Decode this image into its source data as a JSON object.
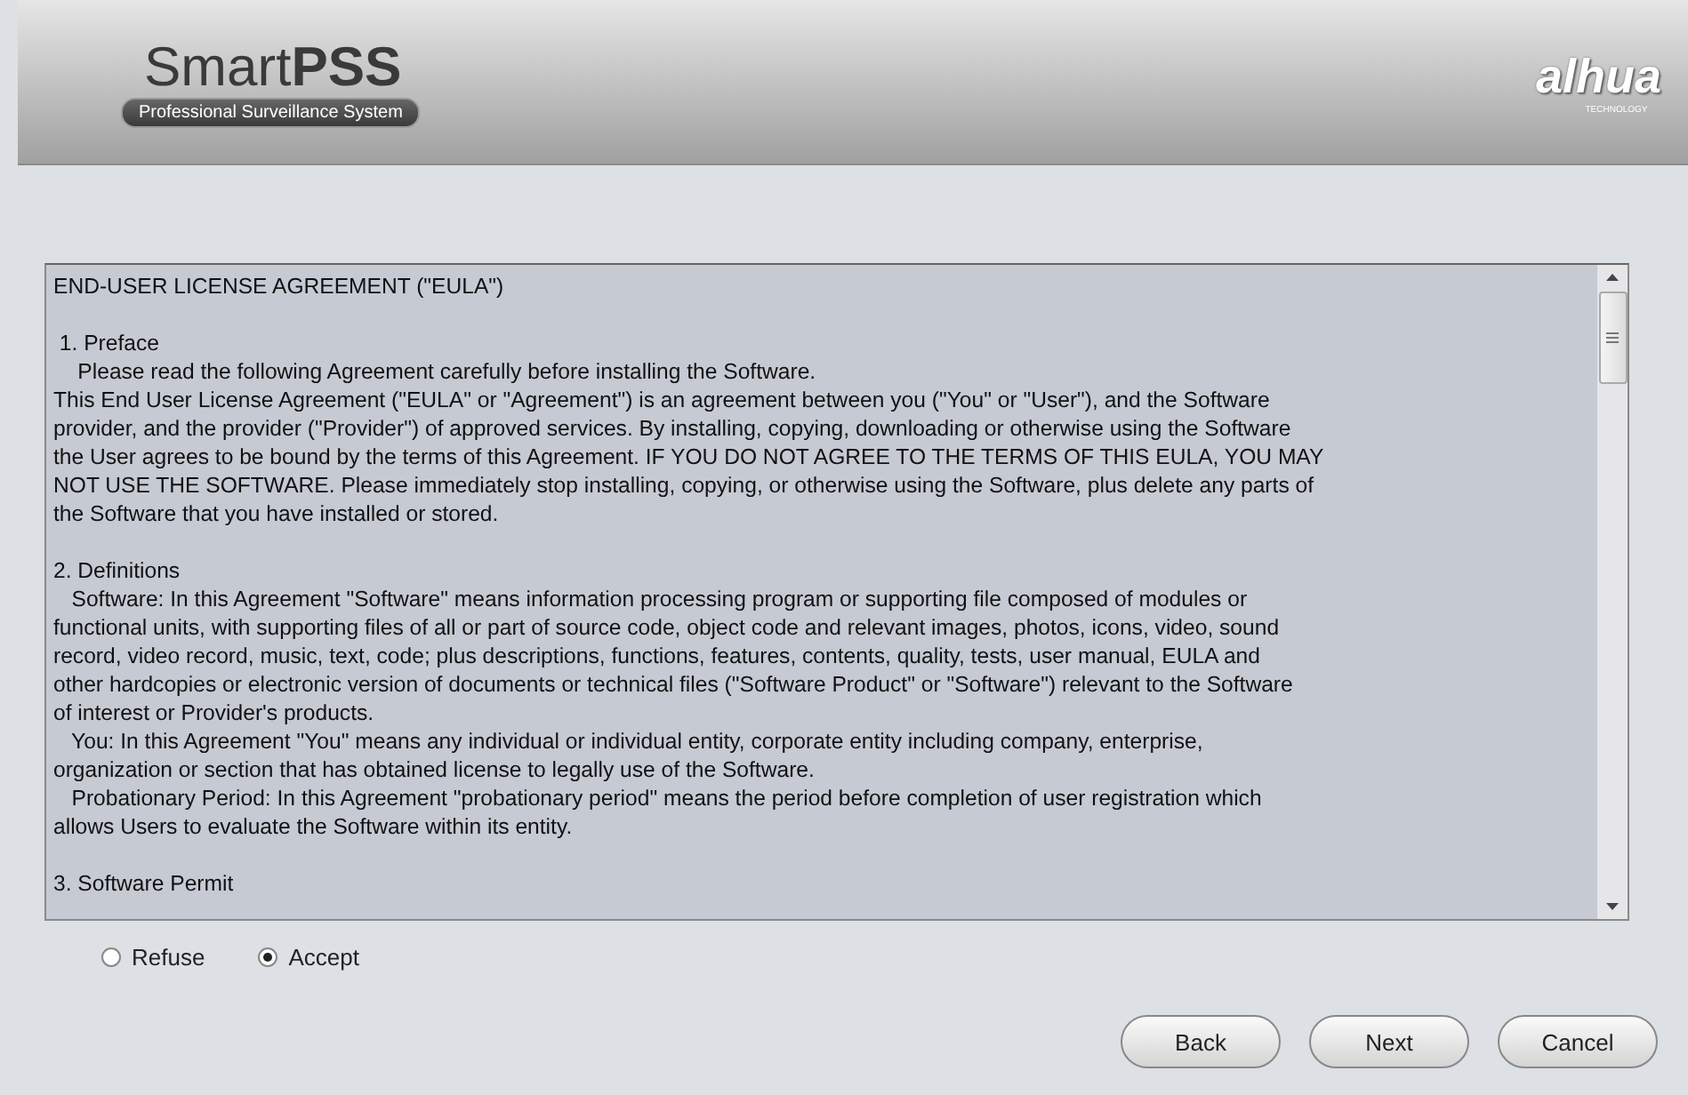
{
  "header": {
    "product": {
      "light": "Smart",
      "bold": "PSS"
    },
    "tagline": "Professional Surveillance System",
    "vendor_logo": {
      "text": "alhua",
      "sub": "TECHNOLOGY"
    }
  },
  "license": {
    "blocks": [
      {
        "lines": [
          "END-USER LICENSE AGREEMENT (\"EULA\")"
        ]
      },
      {
        "lines": [
          " 1. Preface",
          "    Please read the following Agreement carefully before installing the Software.",
          "This End User License Agreement (\"EULA\" or \"Agreement\") is an agreement between you (\"You\" or \"User\"), and the Software",
          "provider, and the provider (\"Provider\") of approved services. By installing, copying, downloading or otherwise using the Software",
          "the User agrees to be bound by the terms of this Agreement. IF YOU DO NOT AGREE TO THE TERMS OF THIS EULA, YOU MAY",
          "NOT USE THE SOFTWARE. Please immediately stop installing, copying, or otherwise using the Software, plus delete any parts of",
          "the Software that you have installed or stored."
        ]
      },
      {
        "lines": [
          "2. Definitions",
          "   Software: In this Agreement \"Software\" means information processing program or supporting file composed of modules or",
          "functional units, with supporting files of all or part of source code, object code and relevant images, photos, icons, video, sound",
          "record, video record, music, text, code; plus descriptions, functions, features, contents, quality, tests, user manual, EULA and",
          "other hardcopies or electronic version of documents or technical files (\"Software Product\" or \"Software\") relevant to the Software",
          "of interest or Provider's products.",
          "   You: In this Agreement \"You\" means any individual or individual entity, corporate entity including company, enterprise,",
          "organization or section that has obtained license to legally use of the Software.",
          "   Probationary Period: In this Agreement \"probationary period\" means the period before completion of user registration which",
          "allows Users to evaluate the Software within its entity."
        ]
      },
      {
        "lines": [
          "3. Software Permit"
        ]
      }
    ]
  },
  "choices": [
    {
      "label": "Refuse",
      "selected": false
    },
    {
      "label": "Accept",
      "selected": true
    }
  ],
  "buttons": [
    "Back",
    "Next",
    "Cancel"
  ]
}
